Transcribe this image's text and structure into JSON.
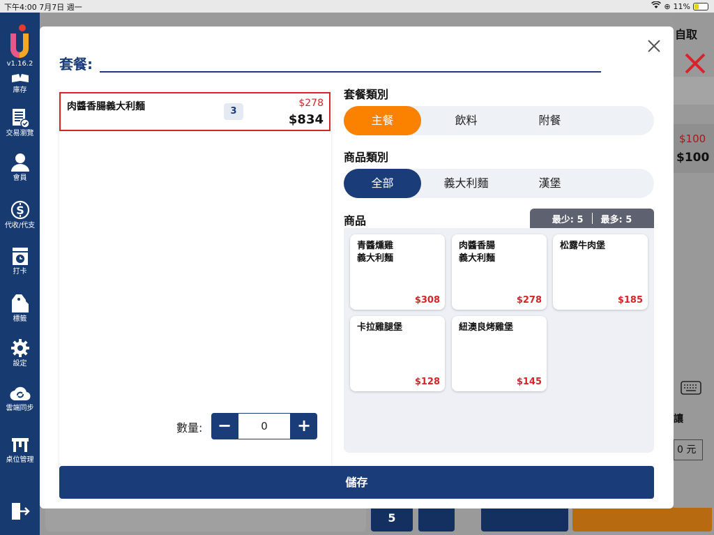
{
  "status_bar": {
    "time_date": "下午4:00  7月7日 週一",
    "battery": "11%"
  },
  "sidebar": {
    "version": "v1.16.2",
    "items": [
      {
        "label": "庫存",
        "icon": "inventory-icon"
      },
      {
        "label": "交易瀏覽",
        "icon": "transactions-icon"
      },
      {
        "label": "會員",
        "icon": "member-icon"
      },
      {
        "label": "代收/代支",
        "icon": "collect-pay-icon"
      },
      {
        "label": "打卡",
        "icon": "clock-in-icon"
      },
      {
        "label": "標籤",
        "icon": "label-icon"
      },
      {
        "label": "設定",
        "icon": "settings-icon"
      },
      {
        "label": "雲端同步",
        "icon": "cloud-sync-icon"
      },
      {
        "label": "桌位管理",
        "icon": "table-icon"
      }
    ]
  },
  "background": {
    "pickup_label": "自取",
    "price_red": "$100",
    "price_black": "$100",
    "discount_label": "讓",
    "discount_value": "0 元",
    "num_btn": "5"
  },
  "modal": {
    "title": "套餐:",
    "order_items": [
      {
        "name": "肉醬香腸義大利麵",
        "qty": "3",
        "unit_price": "$278",
        "total": "$834"
      }
    ],
    "quantity_label": "數量:",
    "quantity_value": "0",
    "set_category_label": "套餐類別",
    "set_categories": [
      "主餐",
      "飲料",
      "附餐"
    ],
    "product_category_label": "商品類別",
    "product_categories": [
      "全部",
      "義大利麵",
      "漢堡"
    ],
    "products_label": "商品",
    "min_label": "最少: 5",
    "max_label": "最多: 5",
    "products": [
      {
        "name": "青醬燻雞\n義大利麵",
        "price": "$308"
      },
      {
        "name": "肉醬香腸\n義大利麵",
        "price": "$278"
      },
      {
        "name": "松露牛肉堡",
        "price": "$185"
      },
      {
        "name": "卡拉雞腿堡",
        "price": "$128"
      },
      {
        "name": "紐澳良烤雞堡",
        "price": "$145"
      }
    ],
    "save_label": "儲存"
  },
  "colors": {
    "primary": "#1a3c78",
    "accent": "#fb8200",
    "danger": "#d8232a"
  }
}
